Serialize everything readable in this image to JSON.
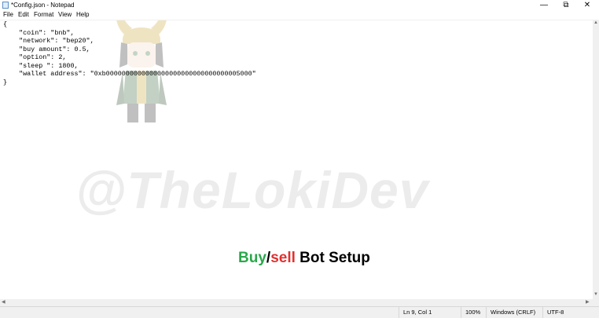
{
  "window": {
    "title": "*Config.json - Notepad",
    "minimize_glyph": "—",
    "maximize_glyph": "⧉",
    "close_glyph": "✕"
  },
  "menu": {
    "items": [
      "File",
      "Edit",
      "Format",
      "View",
      "Help"
    ]
  },
  "editor": {
    "lines": [
      "{",
      "    \"coin\": \"bnb\",",
      "    \"network\": \"bep20\",",
      "    \"buy amount\": 0.5,",
      "    \"option\": 2,",
      "    \"sleep \": 1800,",
      "    \"wallet address\": \"0xb0000000000000000000000000000000005000\"",
      "}"
    ]
  },
  "overlay": {
    "watermark": "@TheLokiDev",
    "caption_buy": "Buy",
    "caption_slash": "/",
    "caption_sell": "sell",
    "caption_rest": " Bot Setup",
    "colors": {
      "buy": "#2aa84a",
      "sell": "#e0312f"
    }
  },
  "statusbar": {
    "position": "Ln 9, Col 1",
    "zoom": "100%",
    "line_ending": "Windows (CRLF)",
    "encoding": "UTF-8"
  }
}
